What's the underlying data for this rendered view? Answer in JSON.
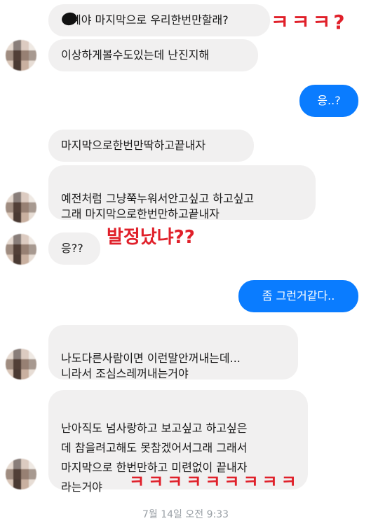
{
  "messages": {
    "m1": "예야 마지막으로 우리한번만할래?",
    "m2": "이상하게볼수도있는데 난진지해",
    "m3": "응..?",
    "m4": "마지막으로한번만딱하고끝내자",
    "m5": "예전처럼 그냥쭉누워서안고싶고 하고싶고\n그래 마지막으로한번만하고끝내자",
    "m6": "응??",
    "m7": "좀 그런거같다..",
    "m8": "나도다른사람이면 이런말안꺼내는데...\n니라서 조심스레꺼내는거야",
    "m9": "난아직도 넘사랑하고 보고싶고 하고싶은\n데 참을려고해도 못참겠어서그래 그래서\n마지막으로 한번만하고 미련없이 끝내자\n라는거야"
  },
  "annotations": {
    "a1": "ㅋㅋㅋ?",
    "a2": "발정났냐??",
    "a3": "ㅋㅋㅋㅋㅋㅋㅋㅋㅋ"
  },
  "timestamp": "7월 14일 오전 9:33",
  "colors": {
    "outgoing": "#0a7cff",
    "incoming": "#f1f0f0",
    "annotation": "#e0202a"
  }
}
